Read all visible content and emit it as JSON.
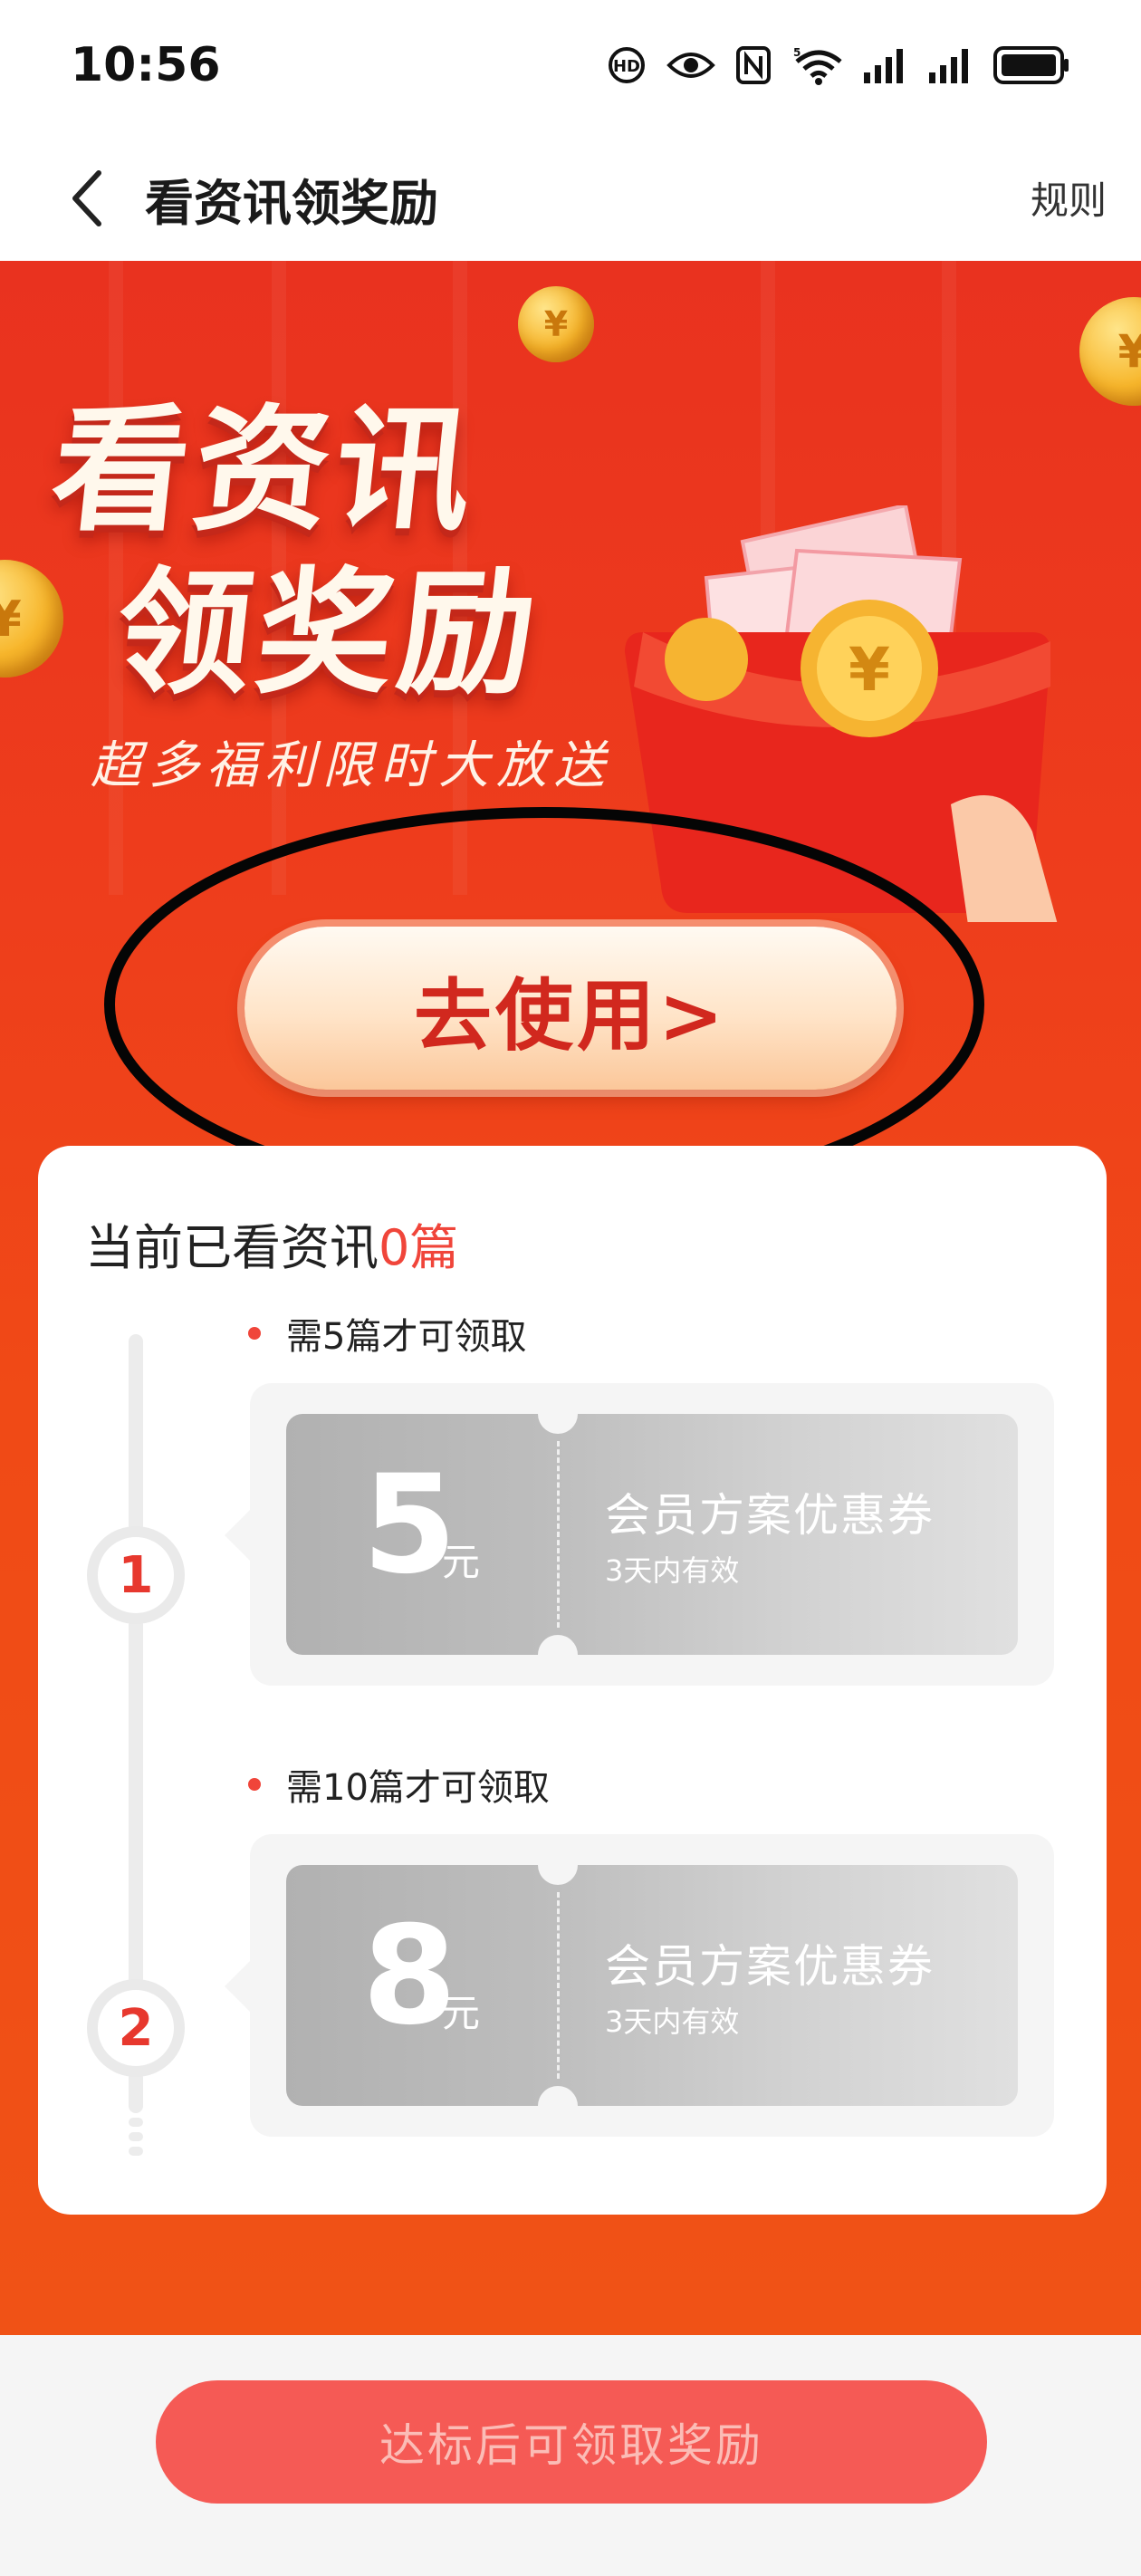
{
  "status_bar": {
    "time": "10:56",
    "network_type": "5"
  },
  "nav": {
    "title": "看资讯领奖励",
    "rules_label": "规则"
  },
  "hero": {
    "title_line1": "看资讯",
    "title_line2": "领奖励",
    "subtitle": "超多福利限时大放送",
    "coin_symbol": "¥",
    "use_button_label": "去使用>"
  },
  "progress": {
    "label": "当前已看资讯",
    "count": "0篇"
  },
  "rewards": [
    {
      "step": "1",
      "requirement": "需5篇才可领取",
      "amount": "5",
      "unit": "元",
      "name": "会员方案优惠券",
      "validity": "3天内有效"
    },
    {
      "step": "2",
      "requirement": "需10篇才可领取",
      "amount": "8",
      "unit": "元",
      "name": "会员方案优惠券",
      "validity": "3天内有效"
    }
  ],
  "footer": {
    "claim_button_label": "达标后可领取奖励"
  },
  "colors": {
    "brand_red": "#e9321f",
    "accent_red": "#f0453a",
    "claim_button": "#f55a55"
  }
}
